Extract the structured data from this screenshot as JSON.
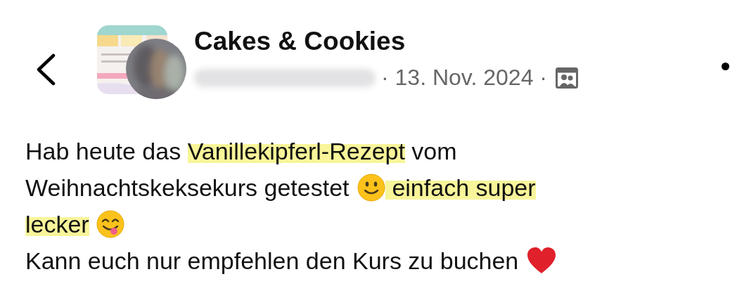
{
  "header": {
    "group_name": "Cakes & Cookies",
    "date": "· 13. Nov. 2024 ·"
  },
  "post_lines": [
    [
      {
        "kind": "text",
        "text": "Hab heute das ",
        "highlighted": false
      },
      {
        "kind": "text",
        "text": "Vanillekipferl-Rezept",
        "highlighted": true
      },
      {
        "kind": "text",
        "text": " vom",
        "highlighted": false
      }
    ],
    [
      {
        "kind": "text",
        "text": "Weihnachtskeksekurs getestet ",
        "highlighted": false
      },
      {
        "kind": "smiley"
      },
      {
        "kind": "text",
        "text": " einfach super",
        "highlighted": true
      }
    ],
    [
      {
        "kind": "text",
        "text": "lecker",
        "highlighted": true
      },
      {
        "kind": "yum"
      }
    ],
    [
      {
        "kind": "text",
        "text": "Kann euch nur empfehlen den Kurs zu buchen ",
        "highlighted": false
      },
      {
        "kind": "heart"
      }
    ]
  ]
}
